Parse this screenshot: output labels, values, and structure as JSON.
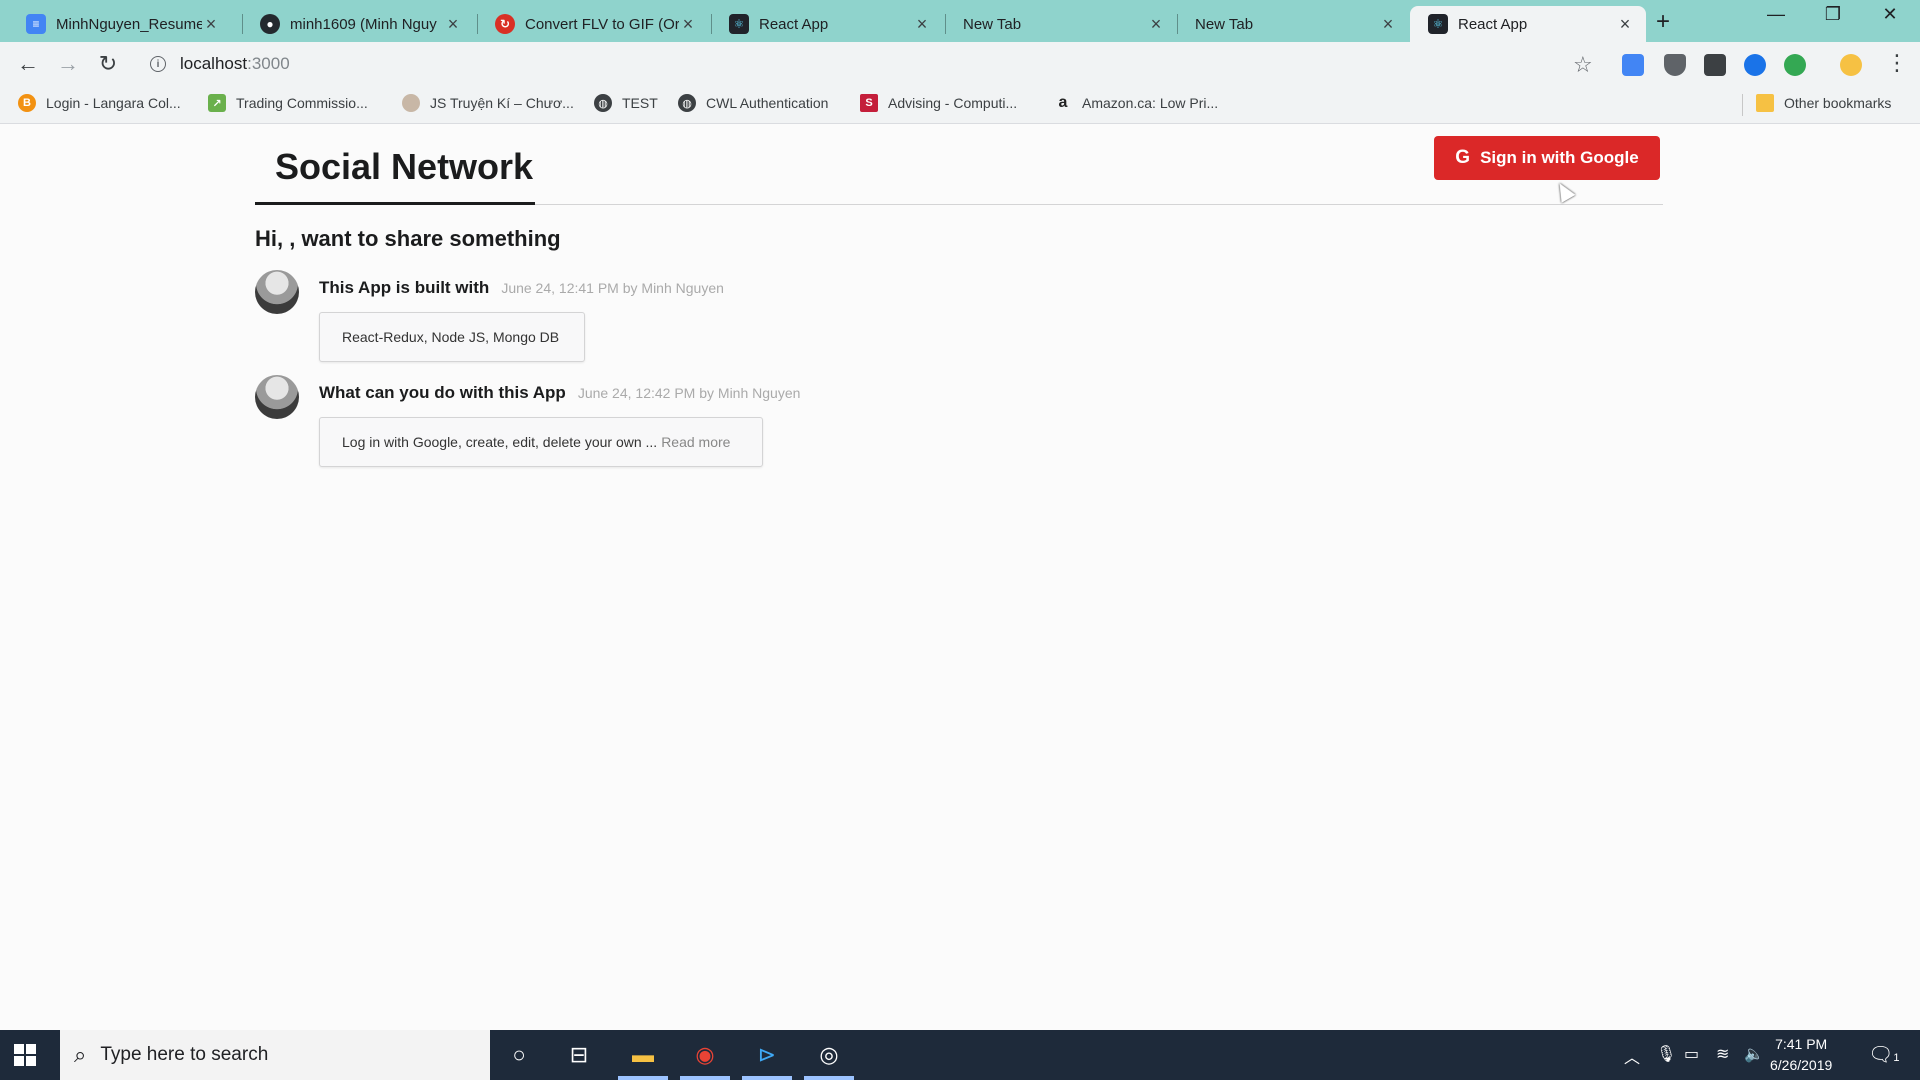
{
  "browser": {
    "tabs": [
      {
        "title": "MinhNguyen_Resume",
        "icon": "docs-icon",
        "color": "#4285f4"
      },
      {
        "title": "minh1609 (Minh Nguy",
        "icon": "github-icon",
        "color": "#24292e"
      },
      {
        "title": "Convert FLV to GIF (Or",
        "icon": "convert-icon",
        "color": "#d93025"
      },
      {
        "title": "React App",
        "icon": "react-icon",
        "color": "#20232a"
      },
      {
        "title": "New Tab",
        "icon": "",
        "color": ""
      },
      {
        "title": "New Tab",
        "icon": "",
        "color": ""
      },
      {
        "title": "React App",
        "icon": "react-icon",
        "color": "#20232a",
        "active": true
      }
    ],
    "url_host": "localhost",
    "url_port": ":3000",
    "bookmarks": [
      {
        "label": "Login - Langara Col...",
        "icon": "langara-icon",
        "color": "#f29111"
      },
      {
        "label": "Trading Commissio...",
        "icon": "trading-icon",
        "color": "#6ab04c"
      },
      {
        "label": "JS Truyện Kí – Chươ...",
        "icon": "js-icon",
        "color": "#c8b7a6"
      },
      {
        "label": "TEST",
        "icon": "globe-icon",
        "color": "#3c4043"
      },
      {
        "label": "CWL Authentication",
        "icon": "globe-icon",
        "color": "#3c4043"
      },
      {
        "label": "Advising - Computi...",
        "icon": "sfu-icon",
        "color": "#c41e3a"
      },
      {
        "label": "Amazon.ca: Low Pri...",
        "icon": "amazon-icon",
        "color": "#222"
      }
    ],
    "other_bookmarks": "Other bookmarks"
  },
  "app": {
    "brand": "Social Network",
    "sign_in_label": "Sign in with Google",
    "greeting": "Hi, , want to share something",
    "accent": "#db2828"
  },
  "posts": [
    {
      "title": "This App is built with",
      "meta": "June 24, 12:41 PM by Minh Nguyen",
      "content": "React-Redux, Node JS, Mongo DB",
      "more": ""
    },
    {
      "title": "What can you do with this App",
      "meta": "June 24, 12:42 PM by Minh Nguyen",
      "content": "Log in with Google, create, edit, delete your own ...",
      "more": "Read more"
    }
  ],
  "taskbar": {
    "search_placeholder": "Type here to search",
    "time": "7:41 PM",
    "date": "6/26/2019",
    "notification_count": "1"
  }
}
